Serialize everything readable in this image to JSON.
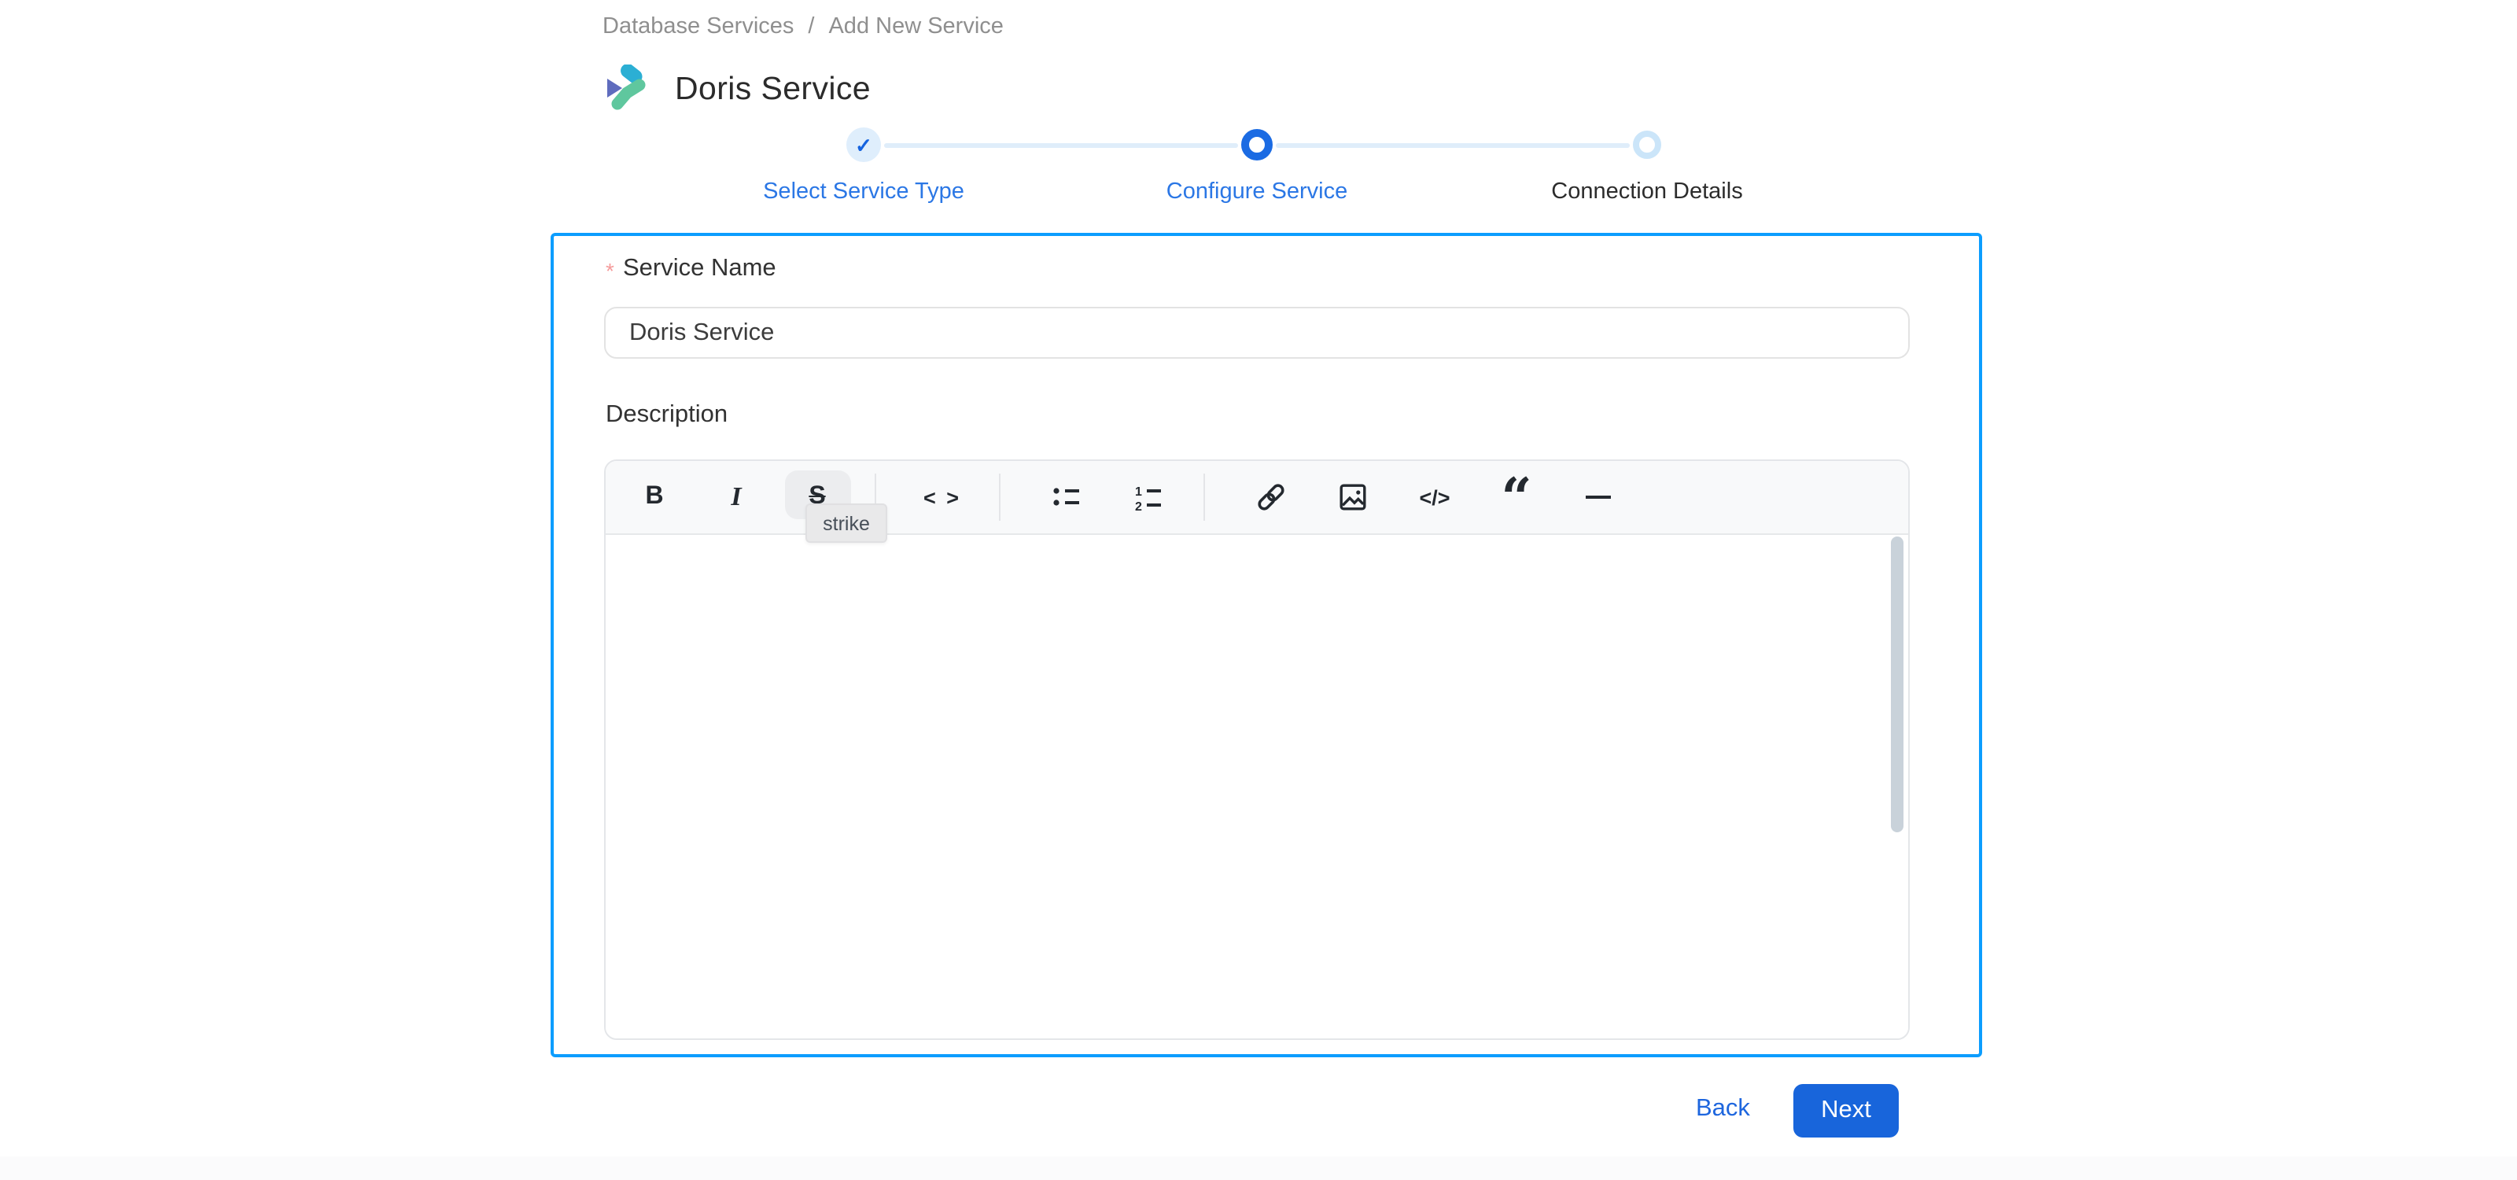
{
  "breadcrumb": {
    "items": [
      "Database Services",
      "Add New Service"
    ],
    "separator": "/"
  },
  "header": {
    "title": "Doris Service",
    "logo": "doris-logo"
  },
  "stepper": {
    "check_glyph": "✓",
    "steps": [
      {
        "label": "Select Service Type",
        "state": "completed"
      },
      {
        "label": "Configure Service",
        "state": "active"
      },
      {
        "label": "Connection Details",
        "state": "upcoming"
      }
    ]
  },
  "form": {
    "service_name": {
      "label": "Service Name",
      "required_marker": "*",
      "value": "Doris Service"
    },
    "description": {
      "label": "Description",
      "value": ""
    }
  },
  "editor": {
    "tooltip": "strike",
    "toolbar": [
      {
        "name": "bold",
        "glyph": "B"
      },
      {
        "name": "italic",
        "glyph": "I"
      },
      {
        "name": "strike",
        "glyph": "S",
        "hovered": true
      },
      {
        "name": "inline-code",
        "glyph": "< >"
      },
      {
        "name": "bullet-list",
        "glyph": ""
      },
      {
        "name": "ordered-list",
        "glyph": ""
      },
      {
        "name": "link",
        "glyph": ""
      },
      {
        "name": "image",
        "glyph": ""
      },
      {
        "name": "code-block",
        "glyph": "</>"
      },
      {
        "name": "blockquote",
        "glyph": "“"
      },
      {
        "name": "horizontal-rule",
        "glyph": ""
      }
    ]
  },
  "actions": {
    "back": "Back",
    "next": "Next"
  },
  "colors": {
    "panel_border": "#0c9dfe",
    "step_blue": "#1b6be3",
    "step_label_blue": "#2b77e5",
    "link_blue": "#1e66de",
    "next_button_blue": "#1865db",
    "required_pink": "#f59b9b",
    "logo_cyan": "#2bafd4",
    "logo_purple": "#5f6cbe",
    "logo_green": "#5fc79e"
  }
}
